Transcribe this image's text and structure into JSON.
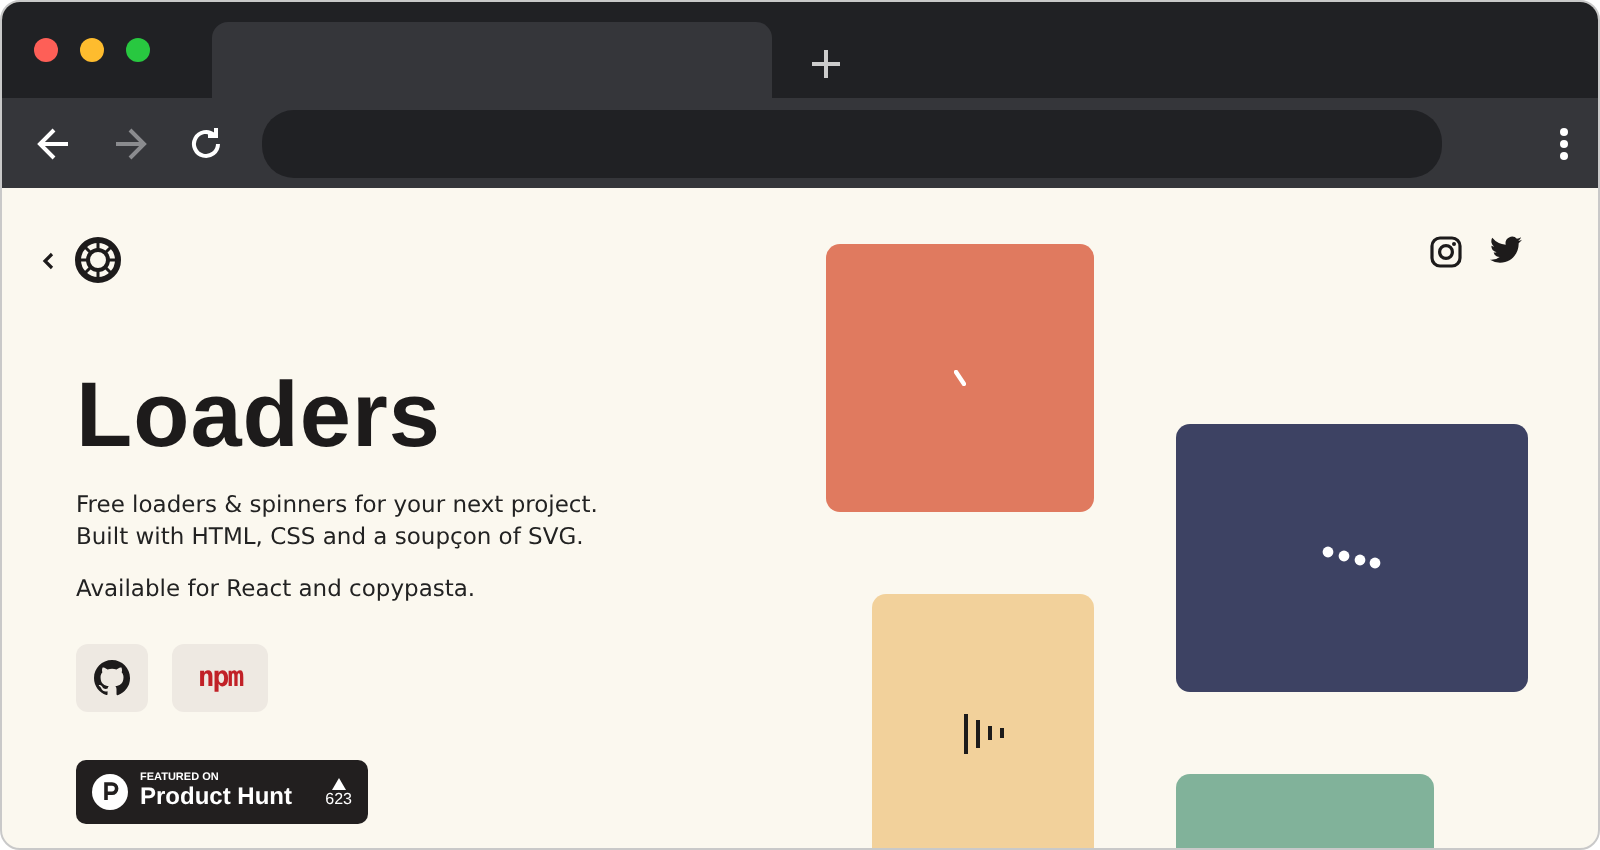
{
  "browser": {
    "nav": [
      {
        "kind": "back",
        "disabled": false
      },
      {
        "kind": "forward",
        "disabled": true
      },
      {
        "kind": "reload",
        "disabled": false
      }
    ]
  },
  "hero": {
    "title": "Loaders",
    "lines": [
      "Free loaders & spinners for your next project.",
      "Built with HTML, CSS and a soupçon of SVG."
    ],
    "note": "Available for React and copypasta.",
    "links": [
      {
        "kind": "github"
      },
      {
        "kind": "npm",
        "label": "npm"
      }
    ],
    "badge": {
      "caption": "FEATURED ON",
      "name": "Product Hunt",
      "votes": "623"
    }
  },
  "tiles": [
    {
      "kind": "spinner",
      "color": "#e07a5f"
    },
    {
      "kind": "bars",
      "color": "#f2d19b"
    },
    {
      "kind": "dots",
      "color": "#3d4263"
    },
    {
      "kind": "none",
      "color": "#81b29a"
    }
  ]
}
